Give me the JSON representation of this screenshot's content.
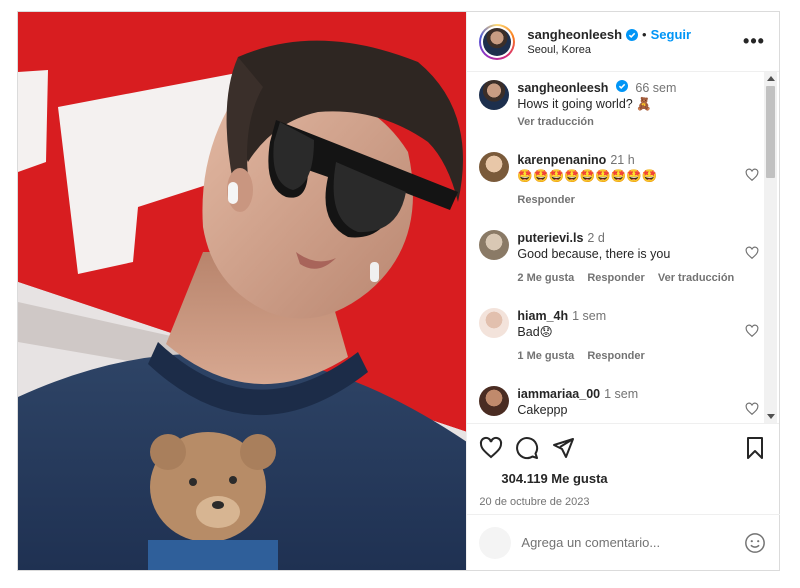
{
  "post": {
    "author": "sangheonleesh",
    "follow_label": "Seguir",
    "location": "Seoul, Korea",
    "more_label": "•••",
    "photo_icon": "bear-sweater-selfie"
  },
  "caption": {
    "author": "sangheonleesh",
    "time": "66 sem",
    "text": "Hows it going world? 🧸",
    "translate_label": "Ver traducción"
  },
  "comments": [
    {
      "author": "karenpenanino",
      "time": "21 h",
      "text": "🤩🤩🤩🤩🤩🤩🤩🤩🤩",
      "likes": "",
      "reply_label": "Responder",
      "translate_label": ""
    },
    {
      "author": "puterievi.ls",
      "time": "2 d",
      "text": "Good because, there is you",
      "likes": "2 Me gusta",
      "reply_label": "Responder",
      "translate_label": "Ver traducción"
    },
    {
      "author": "hiam_4h",
      "time": "1 sem",
      "text": "Bad😟",
      "likes": "1 Me gusta",
      "reply_label": "Responder",
      "translate_label": ""
    },
    {
      "author": "iammariaa_00",
      "time": "1 sem",
      "text": "Cakeppp",
      "likes": "",
      "reply_label": "",
      "translate_label": ""
    }
  ],
  "actions": {
    "like_icon": "heart-icon",
    "comment_icon": "comment-icon",
    "share_icon": "send-icon",
    "save_icon": "bookmark-icon",
    "likes_count": "304.119 Me gusta",
    "date": "20 de octubre de 2023"
  },
  "add_comment": {
    "placeholder": "Agrega un comentario..."
  },
  "colors": {
    "link": "#0095f6",
    "verified": "#0095f6",
    "muted": "#737373"
  }
}
